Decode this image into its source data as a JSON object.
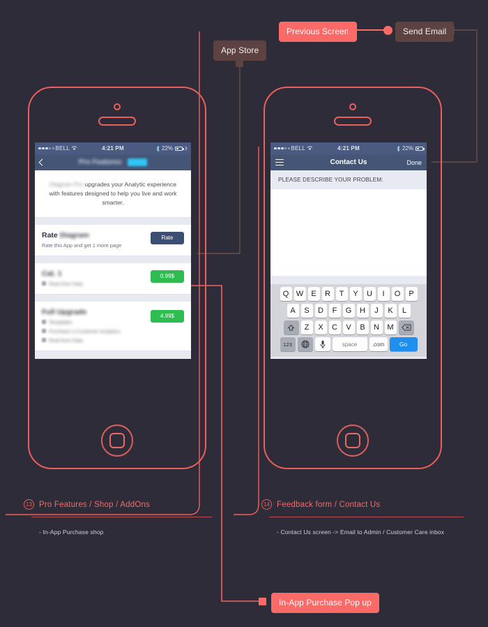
{
  "page": {
    "background": "#2e2c38",
    "accent": "#fc6a68",
    "muted_accent": "#5c4240"
  },
  "callouts": [
    {
      "id": "app-store",
      "label": "App Store",
      "style": "muted"
    },
    {
      "id": "previous-screen",
      "label": "Previous Screen",
      "style": "active"
    },
    {
      "id": "send-email",
      "label": "Send Email",
      "style": "muted"
    },
    {
      "id": "in-app-purchase-popup",
      "label": "In-App Purchase Pop up",
      "style": "active"
    }
  ],
  "phones": [
    {
      "id": "pro-features",
      "status_bar": {
        "carrier": "BELL",
        "time": "4:21 PM",
        "battery_percent": "22%",
        "signal_dots_filled": 3,
        "signal_dots_total": 5,
        "wifi_icon": "wifi-icon",
        "bluetooth_icon": "bluetooth-icon",
        "battery_icon": "battery-icon"
      },
      "navbar": {
        "back_icon": "chevron-left-icon",
        "title": "Pro Features",
        "title_blurred": true,
        "badge": "PRO",
        "badge_color": "#2fc6f5"
      },
      "intro": {
        "brand": "Diagram Pro",
        "text": "upgrades your Analytic experience with features designed to help you live and work smarter."
      },
      "items": [
        {
          "title_plain": "Rate",
          "title_blurred": "Diagram",
          "subtitle": "Rate this App and get 1 more page",
          "subtitle_blurred": false,
          "features": [],
          "button": {
            "label": "Rate",
            "color": "navy"
          }
        },
        {
          "title_plain": "",
          "title_blurred": "Cat. 1",
          "subtitle": "Real time Data",
          "subtitle_blurred": true,
          "features": [],
          "button": {
            "label": "0.99$",
            "color": "green"
          }
        },
        {
          "title_plain": "",
          "title_blurred": "Full Upgrade",
          "subtitle": "",
          "subtitle_blurred": true,
          "features": [
            "Templates",
            "Purchase a Customer Analytics",
            "Real time Data"
          ],
          "button": {
            "label": "4.99$",
            "color": "green"
          }
        }
      ]
    },
    {
      "id": "contact-us",
      "status_bar": {
        "carrier": "BELL",
        "time": "4:21 PM",
        "battery_percent": "22%",
        "signal_dots_filled": 3,
        "signal_dots_total": 5,
        "wifi_icon": "wifi-icon",
        "bluetooth_icon": "bluetooth-icon",
        "battery_icon": "battery-icon"
      },
      "navbar": {
        "menu_icon": "hamburger-icon",
        "title": "Contact Us",
        "right_action": "Done"
      },
      "form": {
        "field_label": "PLEASE DESCRIBE YOUR PROBLEM:",
        "field_value": ""
      },
      "keyboard": {
        "row1": [
          "Q",
          "W",
          "E",
          "R",
          "T",
          "Y",
          "U",
          "I",
          "O",
          "P"
        ],
        "row2": [
          "A",
          "S",
          "D",
          "F",
          "G",
          "H",
          "J",
          "K",
          "L"
        ],
        "row3": [
          "Z",
          "X",
          "C",
          "V",
          "B",
          "N",
          "M"
        ],
        "shift_icon": "shift-up-icon",
        "backspace_icon": "backspace-icon",
        "numeric_key": "123",
        "globe_icon": "globe-icon",
        "mic_icon": "microphone-icon",
        "space_key": "space",
        "dotcom_key": ".com",
        "go_key": "Go"
      }
    }
  ],
  "notes": [
    {
      "number": "13",
      "title": "Pro Features / Shop / AddOns",
      "body": "- In-App Purchase shop"
    },
    {
      "number": "14",
      "title": "Feedback form / Contact Us",
      "body": "- Contact Us screen -> Email to Admin / Customer Care inbox"
    }
  ]
}
